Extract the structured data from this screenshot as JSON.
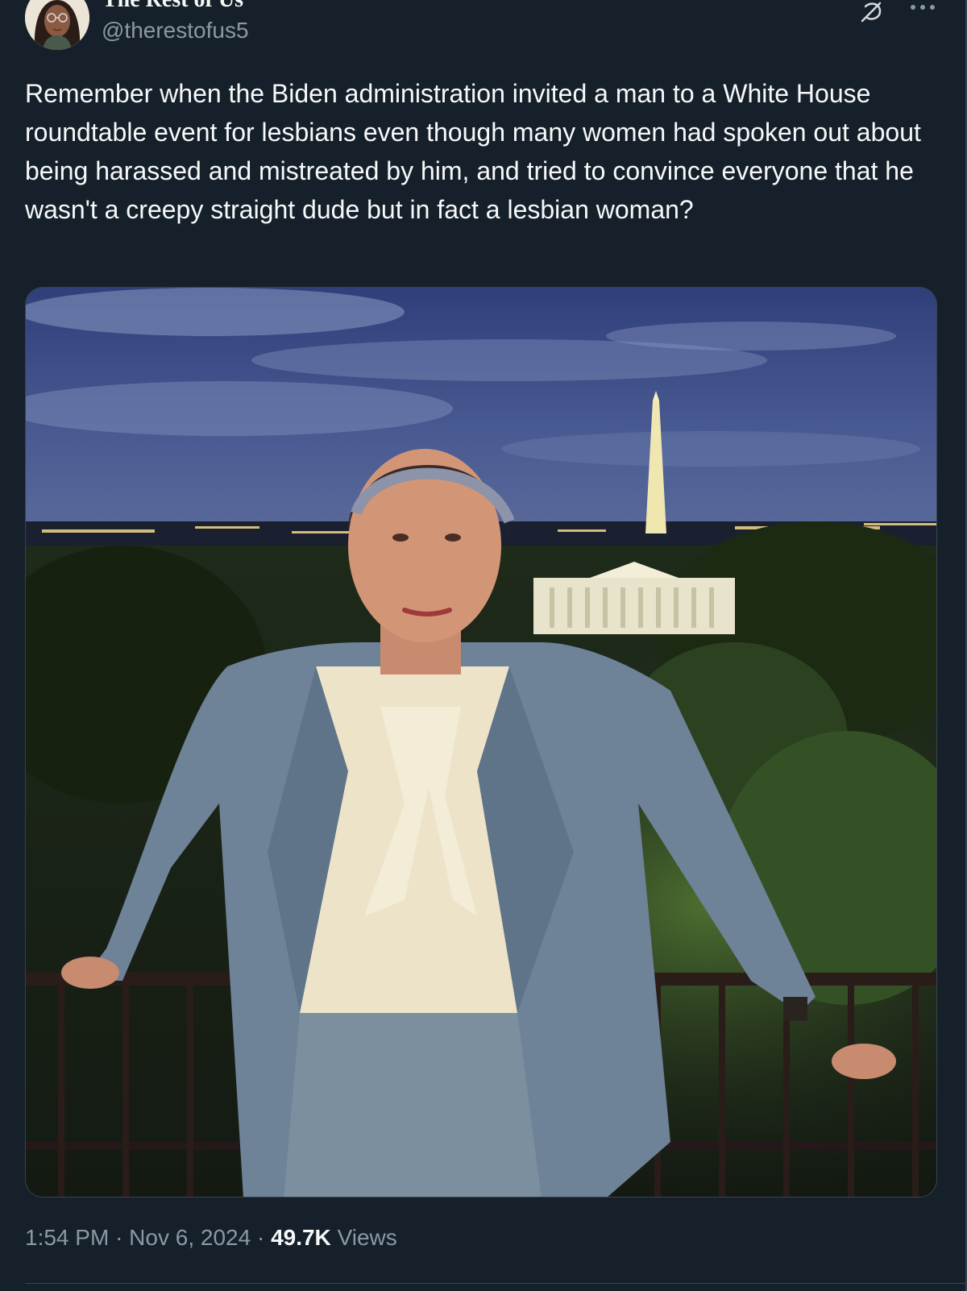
{
  "author": {
    "display_name": "The Rest of Us",
    "handle": "@therestofus5"
  },
  "tweet": {
    "text": "Remember when the Biden administration invited a man to a White House roundtable event for lesbians even though many women had spoken out about being harassed and mistreated by him, and tried to convince everyone that he wasn't a creepy straight dude but in fact a lesbian woman?"
  },
  "meta": {
    "time": "1:54 PM",
    "separator": "·",
    "date": "Nov 6, 2024",
    "views_count": "49.7K",
    "views_label": "Views"
  },
  "icons": {
    "grok": "grok-icon",
    "more": "more-icon"
  },
  "colors": {
    "background": "#15202b",
    "text_primary": "#f7f9f9",
    "text_secondary": "#8b98a5",
    "border": "#38444d"
  }
}
